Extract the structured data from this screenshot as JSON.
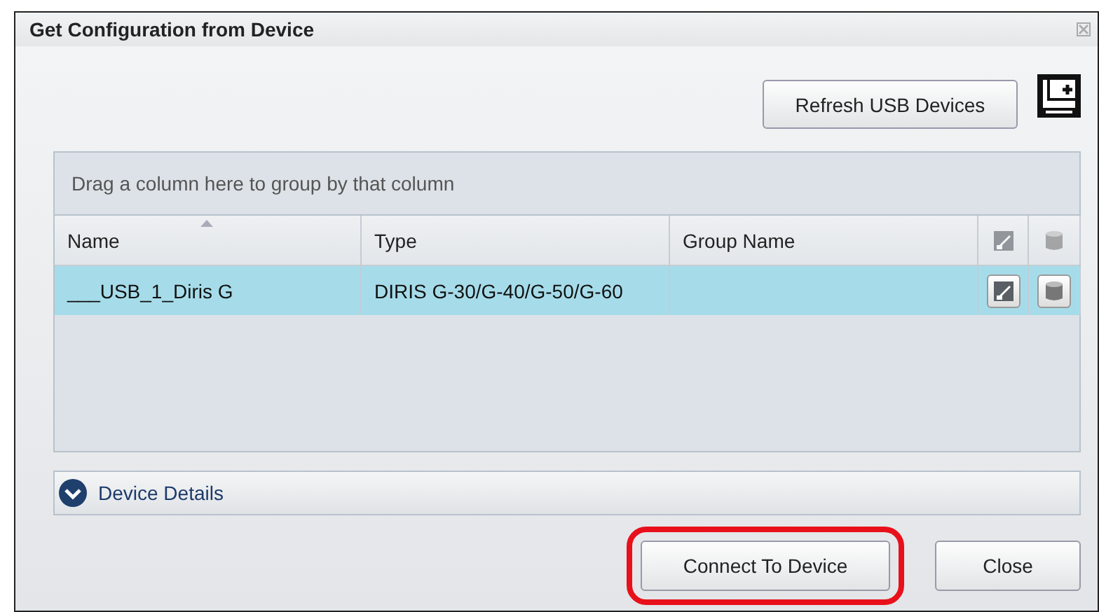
{
  "window": {
    "title": "Get Configuration from Device"
  },
  "toolbar": {
    "refresh_button": "Refresh USB Devices"
  },
  "grid": {
    "group_hint": "Drag a column here to group by that column",
    "columns": [
      {
        "kind": "text",
        "label": "Name",
        "sorted": true
      },
      {
        "kind": "text",
        "label": "Type",
        "sorted": false
      },
      {
        "kind": "text",
        "label": "Group Name",
        "sorted": false
      },
      {
        "kind": "edit-icon"
      },
      {
        "kind": "storage-icon"
      }
    ],
    "rows": [
      {
        "selected": true,
        "cells": [
          "___USB_1_Diris G",
          "DIRIS G-30/G-40/G-50/G-60",
          ""
        ]
      }
    ]
  },
  "details": {
    "label": "Device Details",
    "expanded": false
  },
  "buttons": [
    {
      "label": "Connect To Device",
      "highlighted": true
    },
    {
      "label": "Close",
      "highlighted": false
    }
  ]
}
